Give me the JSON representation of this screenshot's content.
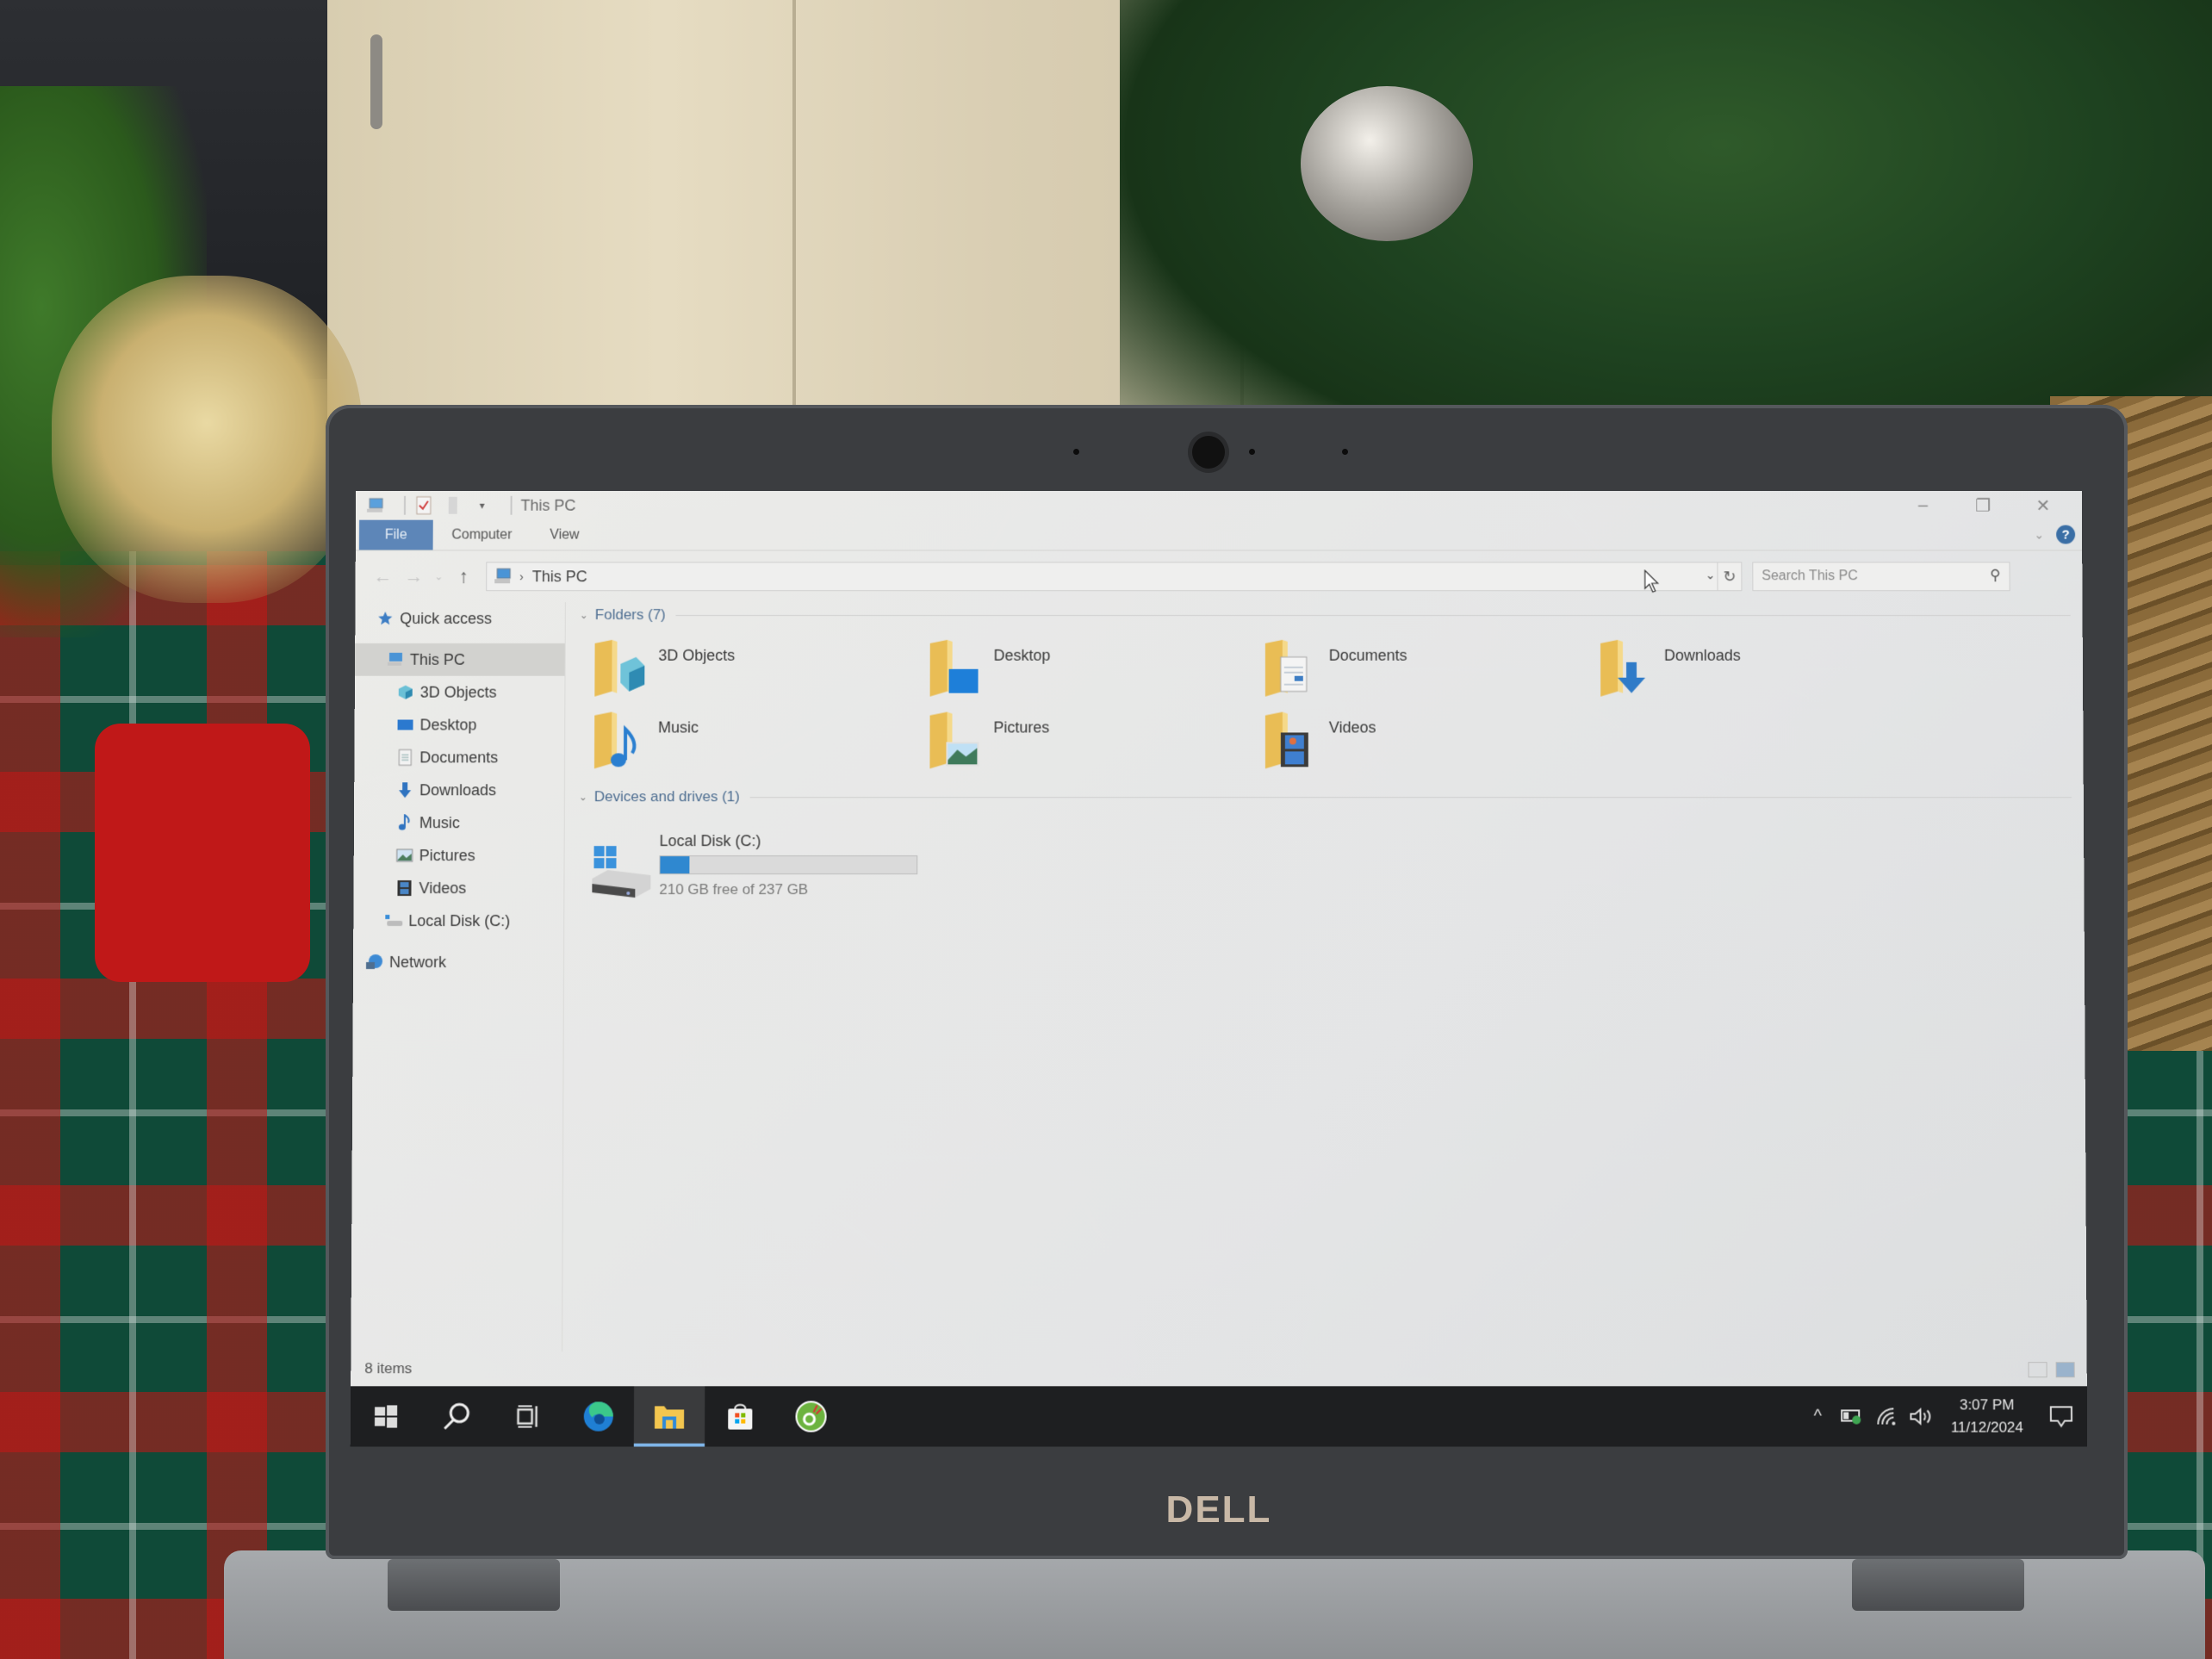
{
  "window": {
    "title": "This PC",
    "controls": {
      "minimize": "–",
      "restore": "❐",
      "close": "✕"
    }
  },
  "ribbon": {
    "tabs": [
      {
        "label": "File",
        "active": true
      },
      {
        "label": "Computer",
        "active": false
      },
      {
        "label": "View",
        "active": false
      }
    ],
    "help": "?",
    "expand": "⌄"
  },
  "navigation": {
    "back": "←",
    "forward": "→",
    "recent": "⌄",
    "up": "↑",
    "breadcrumb_separator": "›",
    "address": "This PC",
    "address_dropdown": "⌄",
    "refresh": "↻",
    "search_placeholder": "Search This PC",
    "search_icon": "⚲"
  },
  "sidebar": {
    "items": [
      {
        "label": "Quick access",
        "icon": "star-icon",
        "level": 0,
        "selected": false
      },
      {
        "label": "This PC",
        "icon": "computer-icon",
        "level": 1,
        "selected": true
      },
      {
        "label": "3D Objects",
        "icon": "cube-icon",
        "level": 2,
        "selected": false
      },
      {
        "label": "Desktop",
        "icon": "desktop-icon",
        "level": 2,
        "selected": false
      },
      {
        "label": "Documents",
        "icon": "document-icon",
        "level": 2,
        "selected": false
      },
      {
        "label": "Downloads",
        "icon": "download-arrow-icon",
        "level": 2,
        "selected": false
      },
      {
        "label": "Music",
        "icon": "music-note-icon",
        "level": 2,
        "selected": false
      },
      {
        "label": "Pictures",
        "icon": "picture-icon",
        "level": 2,
        "selected": false
      },
      {
        "label": "Videos",
        "icon": "film-icon",
        "level": 2,
        "selected": false
      },
      {
        "label": "Local Disk (C:)",
        "icon": "drive-icon",
        "level": 1,
        "selected": false
      },
      {
        "label": "Network",
        "icon": "network-icon",
        "level": 0,
        "selected": false
      }
    ]
  },
  "content": {
    "folders_header": "Folders (7)",
    "folders": [
      {
        "label": "3D Objects",
        "overlay": "cube"
      },
      {
        "label": "Desktop",
        "overlay": "desktop"
      },
      {
        "label": "Documents",
        "overlay": "document"
      },
      {
        "label": "Downloads",
        "overlay": "download"
      },
      {
        "label": "Music",
        "overlay": "music"
      },
      {
        "label": "Pictures",
        "overlay": "picture"
      },
      {
        "label": "Videos",
        "overlay": "film"
      }
    ],
    "drives_header": "Devices and drives (1)",
    "drives": [
      {
        "label": "Local Disk (C:)",
        "free_text": "210 GB free of 237 GB",
        "free_gb": 210,
        "total_gb": 237,
        "used_fraction": 0.114
      }
    ]
  },
  "status": {
    "item_count": "8 items"
  },
  "taskbar": {
    "apps": [
      {
        "name": "start",
        "icon": "windows-logo-icon",
        "active": false
      },
      {
        "name": "search",
        "icon": "search-icon",
        "active": false
      },
      {
        "name": "task-view",
        "icon": "task-view-icon",
        "active": false
      },
      {
        "name": "edge",
        "icon": "edge-browser-icon",
        "active": false
      },
      {
        "name": "file-explorer",
        "icon": "file-explorer-icon",
        "active": true
      },
      {
        "name": "store",
        "icon": "store-icon",
        "active": false
      },
      {
        "name": "coc-coc",
        "icon": "coccoc-browser-icon",
        "active": false
      }
    ],
    "tray": {
      "chevron": "^",
      "time": "3:07 PM",
      "date": "11/12/2024"
    }
  },
  "hardware": {
    "brand": "DELL"
  },
  "colors": {
    "accent": "#5d86b8",
    "drive_fill": "#2f88d0",
    "folder": "#f0c75e",
    "taskbar": "#1e1f21",
    "group_header": "#4f6f92"
  }
}
